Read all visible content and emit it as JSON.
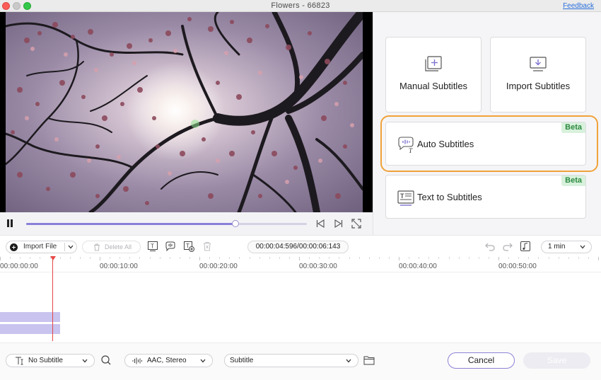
{
  "window": {
    "title": "Flowers - 66823",
    "feedback_link": "Feedback"
  },
  "player": {
    "progress_fraction": 0.7455,
    "accent_color": "#8a7fd8"
  },
  "panel": {
    "manual": {
      "label": "Manual Subtitles",
      "icon": "add-subtitle-icon"
    },
    "import": {
      "label": "Import Subtitles",
      "icon": "import-subtitle-icon"
    },
    "auto": {
      "label": "Auto Subtitles",
      "badge": "Beta",
      "icon": "speech-to-text-icon",
      "highlight_color": "#f0a23a"
    },
    "text_to": {
      "label": "Text to Subtitles",
      "badge": "Beta",
      "icon": "text-document-icon"
    }
  },
  "toolbar": {
    "import_label": "Import File",
    "delete_all_label": "Delete All",
    "time": "00:00:04:596/00:00:06:143",
    "zoom": "1 min"
  },
  "timeline": {
    "labels": [
      "00:00:00:00",
      "00:00:10:00",
      "00:00:20:00",
      "00:00:30:00",
      "00:00:40:00",
      "00:00:50:00"
    ],
    "playhead_color": "#e84646"
  },
  "bottom": {
    "subtitle_select": "No Subtitle",
    "audio_select": "AAC, Stereo",
    "type_select": "Subtitle",
    "cancel_label": "Cancel",
    "save_label": "Save"
  }
}
